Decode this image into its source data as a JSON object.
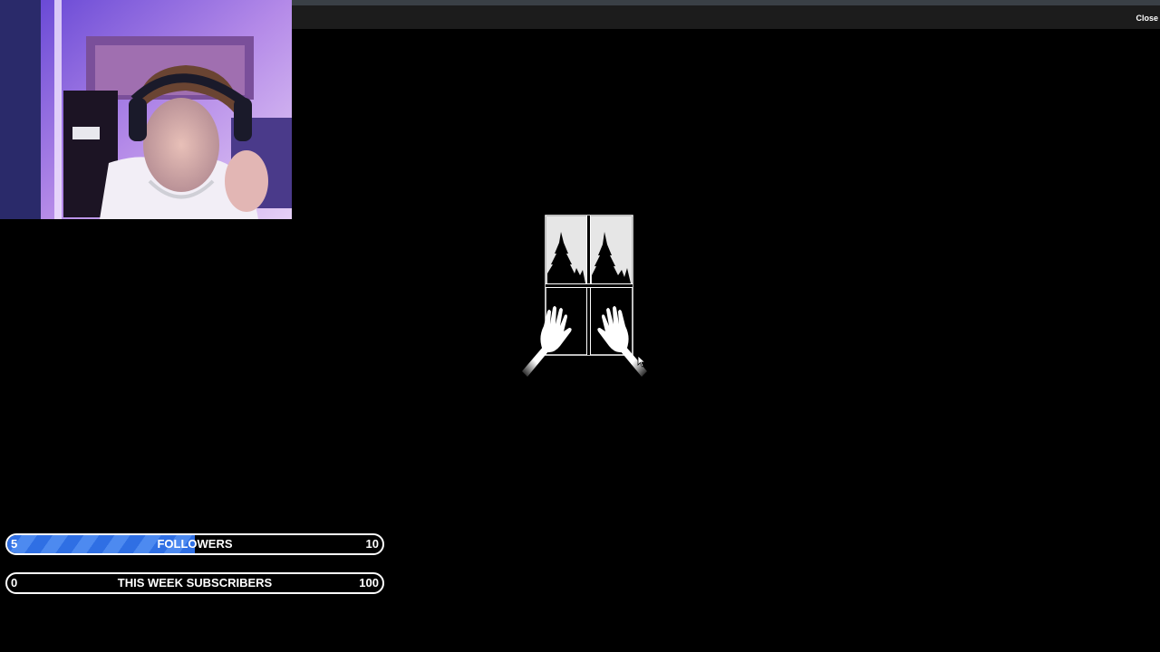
{
  "topbar": {
    "close_label": "Close"
  },
  "webcam": {
    "icon": "webcam-feed"
  },
  "scene": {
    "icon": "window-hands-illustration"
  },
  "goals": {
    "followers": {
      "current": "5",
      "label": "FOLLOWERS",
      "target": "10",
      "progress": 0.5,
      "fill_color": "#2f6fe4"
    },
    "subscribers": {
      "current": "0",
      "label": "THIS WEEK SUBSCRIBERS",
      "target": "100",
      "progress": 0.0,
      "fill_color": "#2f6fe4"
    }
  }
}
